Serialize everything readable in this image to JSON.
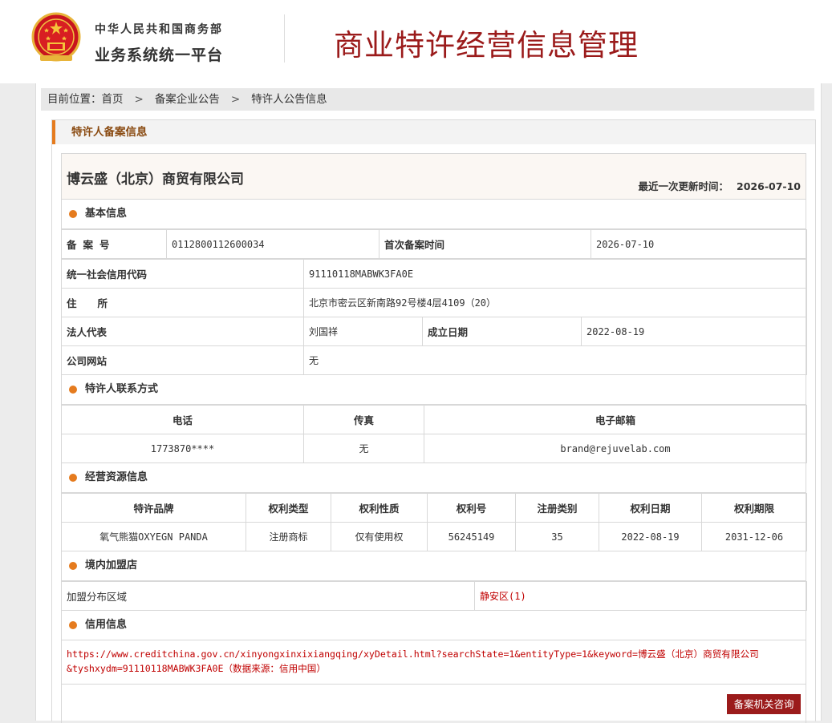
{
  "header": {
    "org_line1": "中华人民共和国商务部",
    "org_line2": "业务系统统一平台",
    "title": "商业特许经营信息管理"
  },
  "breadcrumb": {
    "prefix": "目前位置：",
    "items": [
      "首页",
      "备案企业公告",
      "特许人公告信息"
    ],
    "separator": ">"
  },
  "panel_title": "特许人备案信息",
  "company": {
    "name": "博云盛（北京）商贸有限公司",
    "update_label": "最近一次更新时间：",
    "update_value": "2026-07-10"
  },
  "basic": {
    "section_title": "基本信息",
    "record_no_label": "备案号",
    "record_no_value": "0112800112600034",
    "first_record_label": "首次备案时间",
    "first_record_value": "2026-07-10",
    "credit_code_label": "统一社会信用代码",
    "credit_code_value": "91110118MABWK3FA0E",
    "address_label": "住所",
    "address_value": "北京市密云区新南路92号楼4层4109（20）",
    "legal_rep_label": "法人代表",
    "legal_rep_value": "刘国祥",
    "founded_label": "成立日期",
    "founded_value": "2022-08-19",
    "website_label": "公司网站",
    "website_value": "无"
  },
  "contact": {
    "section_title": "特许人联系方式",
    "headers": [
      "电话",
      "传真",
      "电子邮箱"
    ],
    "phone": "1773870****",
    "fax": "无",
    "email": "brand@rejuvelab.com"
  },
  "resources": {
    "section_title": "经营资源信息",
    "headers": [
      "特许品牌",
      "权利类型",
      "权利性质",
      "权利号",
      "注册类别",
      "权利日期",
      "权利期限"
    ],
    "rows": [
      [
        "氧气熊猫OXYEGN PANDA",
        "注册商标",
        "仅有使用权",
        "56245149",
        "35",
        "2022-08-19",
        "2031-12-06"
      ]
    ]
  },
  "franchise": {
    "section_title": "境内加盟店",
    "label": "加盟分布区域",
    "value": "静安区(1)"
  },
  "credit": {
    "section_title": "信用信息",
    "link_line1": "https://www.creditchina.gov.cn/xinyongxinxixiangqing/xyDetail.html?searchState=1&entityType=1&keyword=博云盛（北京）商贸有限公司",
    "link_line2": "&tyshxydm=91110118MABWK3FA0E（数据来源：信用中国）"
  },
  "consult_button": "备案机关咨询",
  "colors": {
    "accent_red": "#9b1b1b",
    "orange": "#e57b1e",
    "link_red": "#c00000"
  }
}
